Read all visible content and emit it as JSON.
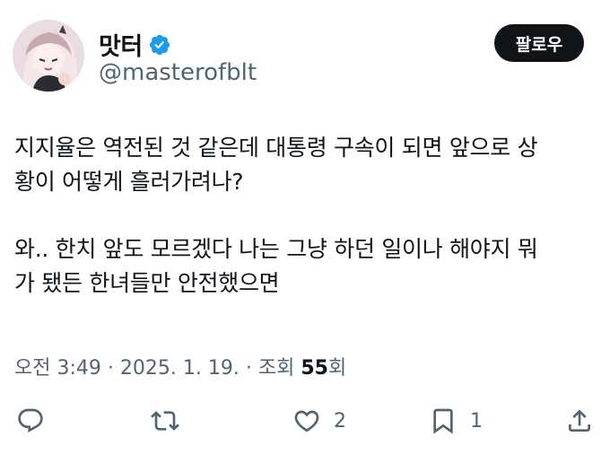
{
  "author": {
    "display_name": "맛터",
    "handle": "@masterofblt",
    "verified_icon": "verified-badge-icon",
    "avatar_icon": "avatar-illustration"
  },
  "follow_label": "팔로우",
  "tweet": {
    "lines": [
      "지지율은 역전된 것 같은데 대통령 구속이 되면 앞으로 상",
      "황이 어떻게 흘러가려나?",
      "와.. 한치 앞도 모르겠다 나는 그냥 하던 일이나 해야지 뭐",
      "가 됐든 한녀들만 안전했으면"
    ]
  },
  "meta": {
    "time": "오전 3:49",
    "sep1": "·",
    "date": "2025. 1. 19.",
    "sep2": "·",
    "views_prefix": "조회",
    "views_count": "55",
    "views_suffix": "회"
  },
  "actions": {
    "reply_icon": "reply-icon",
    "retweet_icon": "retweet-icon",
    "like_icon": "heart-icon",
    "like_count": "2",
    "bookmark_icon": "bookmark-icon",
    "bookmark_count": "1",
    "share_icon": "share-icon"
  },
  "colors": {
    "text": "#0f1419",
    "secondary": "#536471",
    "verified": "#1d9bf0",
    "button_bg": "#0f1419"
  }
}
